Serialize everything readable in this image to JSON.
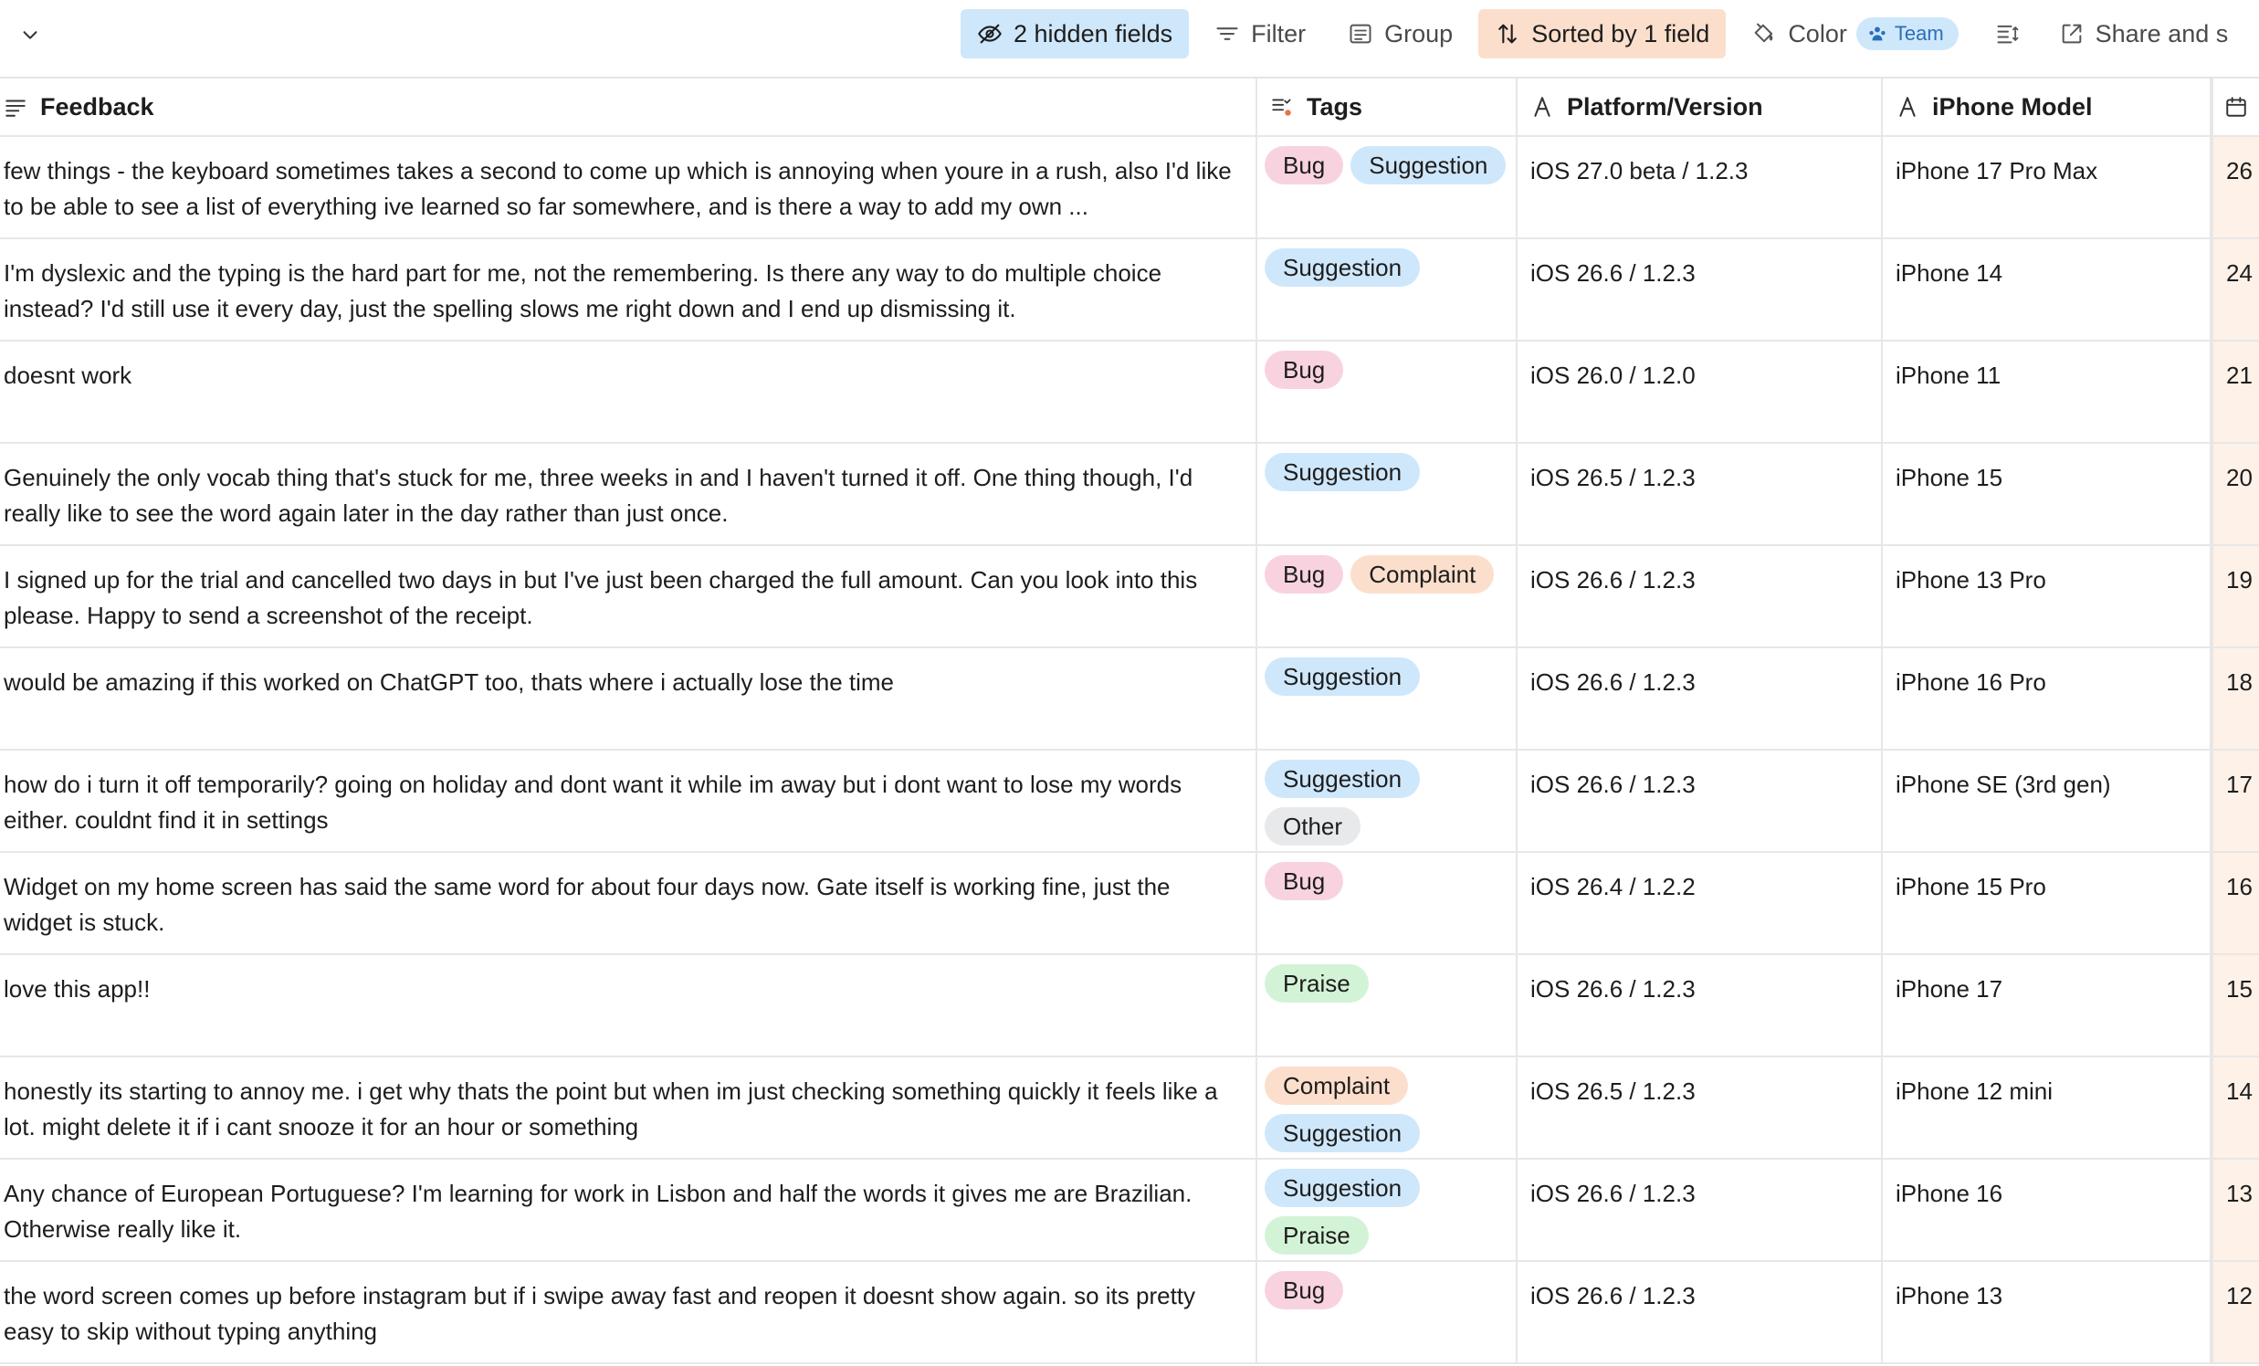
{
  "toolbar": {
    "hidden_fields_label": "2 hidden fields",
    "filter_label": "Filter",
    "group_label": "Group",
    "sorted_label": "Sorted by 1 field",
    "color_label": "Color",
    "team_chip_label": "Team",
    "share_label": "Share and s",
    "icons": [
      "chevron-down-icon",
      "eye-slash-icon",
      "filter-icon",
      "group-icon",
      "sort-icon",
      "paint-bucket-icon",
      "team-icon",
      "row-height-icon",
      "share-icon"
    ]
  },
  "columns": {
    "feedback": "Feedback",
    "tags": "Tags",
    "platform": "Platform/Version",
    "model": "iPhone Model",
    "date": ""
  },
  "tag_colors": {
    "Bug": "#f8d3df",
    "Suggestion": "#cfe7fb",
    "Complaint": "#fbdfcc",
    "Other": "#e8e9eb",
    "Praise": "#d3f3d6"
  },
  "rows": [
    {
      "feedback": "few things - the keyboard sometimes takes a second to come up which is annoying when youre in a rush, also I'd like to be able to see a list of everything ive learned so far somewhere, and is there a way to add my own ...",
      "tags": [
        "Bug",
        "Suggestion"
      ],
      "platform": "iOS 27.0 beta / 1.2.3",
      "model": "iPhone 17 Pro Max",
      "date": "26"
    },
    {
      "feedback": "I'm dyslexic and the typing is the hard part for me, not the remembering. Is there any way to do multiple choice instead? I'd still use it every day, just the spelling slows me right down and I end up dismissing it.",
      "tags": [
        "Suggestion"
      ],
      "platform": "iOS 26.6 / 1.2.3",
      "model": "iPhone 14",
      "date": "24"
    },
    {
      "feedback": "doesnt work",
      "tags": [
        "Bug"
      ],
      "platform": "iOS 26.0 / 1.2.0",
      "model": "iPhone 11",
      "date": "21"
    },
    {
      "feedback": "Genuinely the only vocab thing that's stuck for me, three weeks in and I haven't turned it off. One thing though, I'd really like to see the word again later in the day rather than just once.",
      "tags": [
        "Suggestion"
      ],
      "platform": "iOS 26.5 / 1.2.3",
      "model": "iPhone 15",
      "date": "20"
    },
    {
      "feedback": "I signed up for the trial and cancelled two days in but I've just been charged the full amount. Can you look into this please. Happy to send a screenshot of the receipt.",
      "tags": [
        "Bug",
        "Complaint"
      ],
      "platform": "iOS 26.6 / 1.2.3",
      "model": "iPhone 13 Pro",
      "date": "19"
    },
    {
      "feedback": "would be amazing if this worked on ChatGPT too, thats where i actually lose the time",
      "tags": [
        "Suggestion"
      ],
      "platform": "iOS 26.6 / 1.2.3",
      "model": "iPhone 16 Pro",
      "date": "18"
    },
    {
      "feedback": "how do i turn it off temporarily? going on holiday and dont want it while im away but i dont want to lose my words either. couldnt find it in settings",
      "tags": [
        "Suggestion",
        "Other"
      ],
      "platform": "iOS 26.6 / 1.2.3",
      "model": "iPhone SE (3rd gen)",
      "date": "17"
    },
    {
      "feedback": "Widget on my home screen has said the same word for about four days now. Gate itself is working fine, just the widget is stuck.",
      "tags": [
        "Bug"
      ],
      "platform": "iOS 26.4 / 1.2.2",
      "model": "iPhone 15 Pro",
      "date": "16"
    },
    {
      "feedback": "love this app!!",
      "tags": [
        "Praise"
      ],
      "platform": "iOS 26.6 / 1.2.3",
      "model": "iPhone 17",
      "date": "15"
    },
    {
      "feedback": "honestly its starting to annoy me. i get why thats the point but when im just checking something quickly it feels like a lot. might delete it if i cant snooze it for an hour or something",
      "tags": [
        "Complaint",
        "Suggestion"
      ],
      "platform": "iOS 26.5 / 1.2.3",
      "model": "iPhone 12 mini",
      "date": "14"
    },
    {
      "feedback": "Any chance of European Portuguese? I'm learning for work in Lisbon and half the words it gives me are Brazilian. Otherwise really like it.",
      "tags": [
        "Suggestion",
        "Praise"
      ],
      "platform": "iOS 26.6 / 1.2.3",
      "model": "iPhone 16",
      "date": "13"
    },
    {
      "feedback": "the word screen comes up before instagram but if i swipe away fast and reopen it doesnt show again. so its pretty easy to skip without typing anything",
      "tags": [
        "Bug"
      ],
      "platform": "iOS 26.6 / 1.2.3",
      "model": "iPhone 13",
      "date": "12"
    }
  ]
}
